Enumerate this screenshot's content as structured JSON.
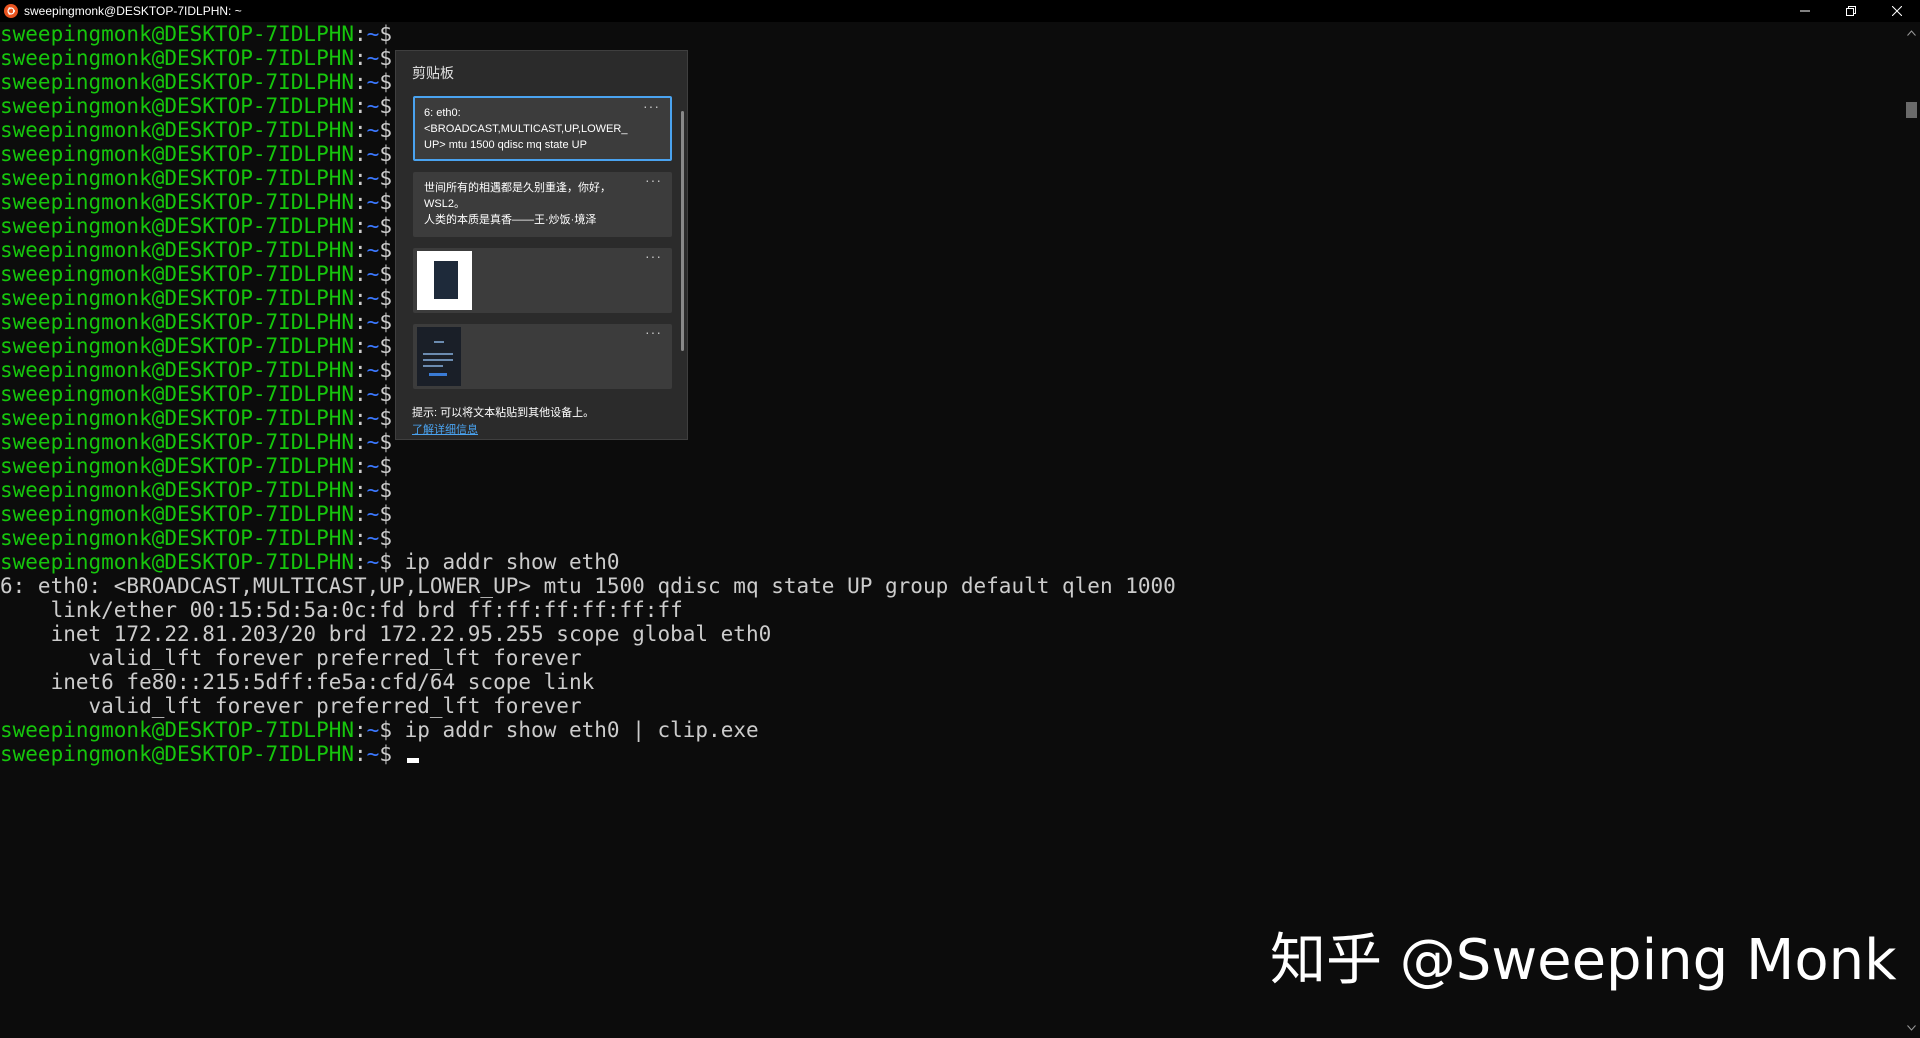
{
  "window": {
    "title": "sweepingmonk@DESKTOP-7IDLPHN: ~",
    "app_icon": "ubuntu-icon",
    "controls": [
      "minimize-icon",
      "restore-icon",
      "close-icon"
    ]
  },
  "colors": {
    "background": "#0c0c0c",
    "prompt_user": "#16c60c",
    "prompt_path": "#3b78ff",
    "text": "#cccccc",
    "panel_bg": "#2b2b2b",
    "item_bg": "#3c3c3c",
    "selected_border": "#4aa3f0",
    "link": "#4aa3f0"
  },
  "terminal": {
    "prompt": {
      "user": "sweepingmonk@DESKTOP-7IDLPHN",
      "colon": ":",
      "path": "~",
      "dollar": "$"
    },
    "empty_prompt_count": 22,
    "command_1": " ip addr show eth0",
    "output": [
      "6: eth0: <BROADCAST,MULTICAST,UP,LOWER_UP> mtu 1500 qdisc mq state UP group default qlen 1000",
      "    link/ether 00:15:5d:5a:0c:fd brd ff:ff:ff:ff:ff:ff",
      "    inet 172.22.81.203/20 brd 172.22.95.255 scope global eth0",
      "       valid_lft forever preferred_lft forever",
      "    inet6 fe80::215:5dff:fe5a:cfd/64 scope link",
      "       valid_lft forever preferred_lft forever"
    ],
    "command_2": " ip addr show eth0 | clip.exe",
    "current_input": " "
  },
  "clipboard": {
    "title": "剪贴板",
    "items": [
      {
        "type": "text",
        "text": "6: eth0:\n<BROADCAST,MULTICAST,UP,LOWER_\nUP> mtu 1500 qdisc mq state UP",
        "more": "···",
        "selected": true
      },
      {
        "type": "text",
        "text": "世间所有的相遇都是久别重逢，你好，\nWSL2。\n人类的本质是真香——王·炒饭·境泽",
        "more": "···",
        "selected": false
      },
      {
        "type": "image",
        "more": "···",
        "selected": false
      },
      {
        "type": "image",
        "more": "···",
        "selected": false
      }
    ],
    "hint": "提示: 可以将文本粘贴到其他设备上。",
    "link": "了解详细信息"
  },
  "watermark": "知乎 @Sweeping Monk"
}
